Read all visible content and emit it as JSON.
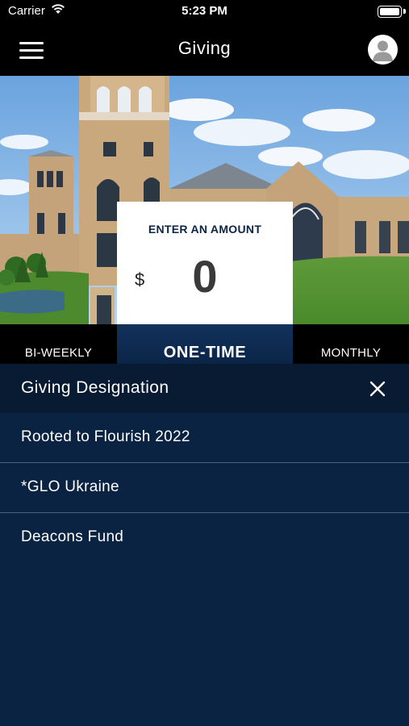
{
  "status_bar": {
    "carrier": "Carrier",
    "time": "5:23 PM"
  },
  "nav": {
    "title": "Giving"
  },
  "amount": {
    "label": "ENTER AN AMOUNT",
    "currency": "$",
    "value": "0"
  },
  "frequency": {
    "left": "BI-WEEKLY",
    "selected": "ONE-TIME",
    "right": "MONTHLY"
  },
  "designation": {
    "title": "Giving Designation",
    "items": [
      "Rooted to Flourish 2022",
      "*GLO Ukraine",
      "Deacons Fund"
    ]
  },
  "colors": {
    "navy": "#0b2342",
    "header_dark": "#081b33",
    "nav_bg": "#000000"
  }
}
